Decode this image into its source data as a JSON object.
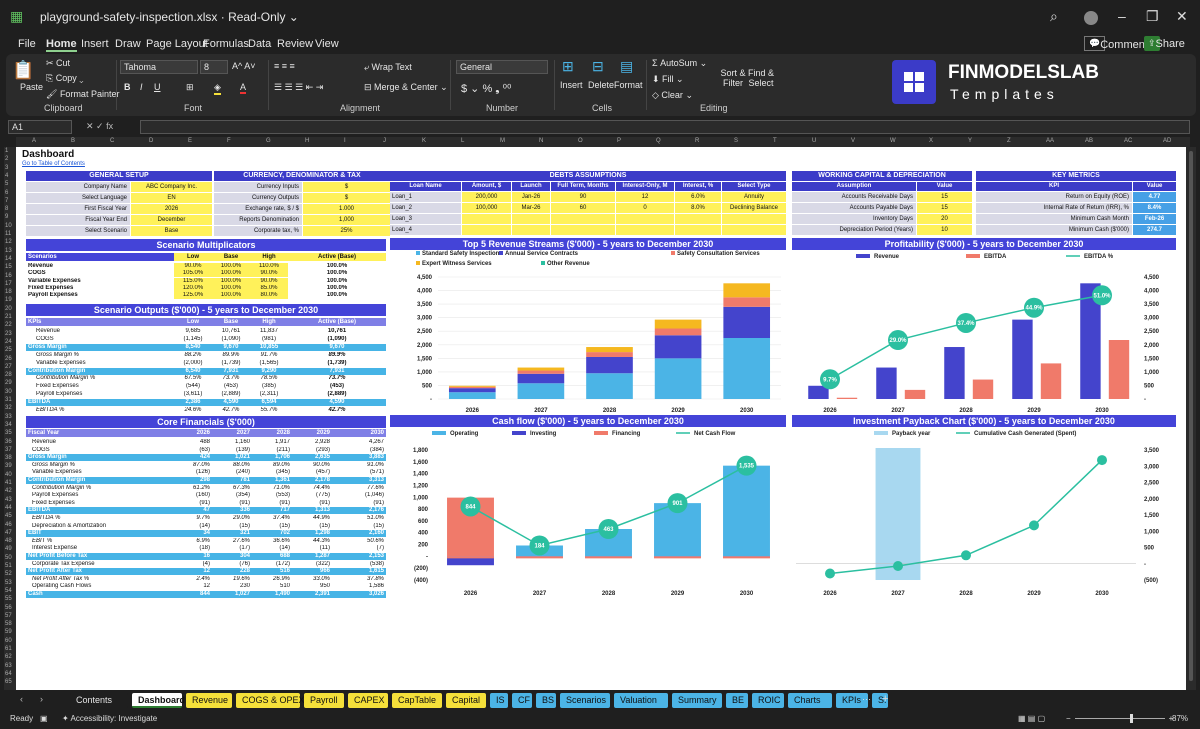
{
  "app": {
    "filename": "playground-safety-inspection.xlsx",
    "mode": "Read-Only",
    "menus": [
      "File",
      "Home",
      "Insert",
      "Draw",
      "Page Layout",
      "Formulas",
      "Data",
      "Review",
      "View"
    ],
    "comments": "Comments",
    "share": "Share"
  },
  "ribbon": {
    "paste": "Paste",
    "cut": "Cut",
    "copy": "Copy",
    "format_painter": "Format Painter",
    "clipboard": "Clipboard",
    "font_name": "Tahoma",
    "font_size": "8",
    "font": "Font",
    "wrap": "Wrap Text",
    "merge": "Merge & Center",
    "alignment": "Alignment",
    "number_format": "General",
    "number": "Number",
    "insert": "Insert",
    "delete": "Delete",
    "format": "Format",
    "cells": "Cells",
    "autosum": "AutoSum",
    "fill": "Fill",
    "clear": "Clear",
    "sort": "Sort & Filter",
    "find": "Find & Select",
    "editing": "Editing",
    "logo1": "FINMODELSLAB",
    "logo2": "Templates"
  },
  "namebox": "A1",
  "columns": [
    "A",
    "B",
    "C",
    "D",
    "E",
    "F",
    "G",
    "H",
    "I",
    "J",
    "K",
    "L",
    "M",
    "N",
    "O",
    "P",
    "Q",
    "R",
    "S",
    "T",
    "U",
    "V",
    "W",
    "X",
    "Y",
    "Z",
    "AA",
    "AB",
    "AC",
    "AD"
  ],
  "sheet": {
    "title": "Dashboard",
    "toc": "Go to Table of Contents"
  },
  "general": {
    "title": "GENERAL SETUP",
    "rows": [
      [
        "Company Name",
        "ABC Company Inc."
      ],
      [
        "Select Language",
        "EN"
      ],
      [
        "First Fiscal Year",
        "2026"
      ],
      [
        "Fiscal Year End",
        "December"
      ],
      [
        "Select Scenario",
        "Base"
      ]
    ]
  },
  "currency": {
    "title": "CURRENCY, DENOMINATOR & TAX",
    "rows": [
      [
        "Currency Inputs",
        "$"
      ],
      [
        "Currency Outputs",
        "$"
      ],
      [
        "Exchange rate, $ / $",
        "1.000"
      ],
      [
        "Reports Denomination",
        "1,000"
      ],
      [
        "Corporate tax, %",
        "25%"
      ]
    ]
  },
  "debts": {
    "title": "DEBTS ASSUMPTIONS",
    "headers": [
      "Loan Name",
      "Amount, $",
      "Launch",
      "Full Term, Months",
      "Interest-Only, M",
      "Interest, %",
      "Select Type"
    ],
    "rows": [
      [
        "Loan_1",
        "200,000",
        "Jan-26",
        "90",
        "12",
        "6.0%",
        "Annuity"
      ],
      [
        "Loan_2",
        "100,000",
        "Mar-26",
        "60",
        "0",
        "8.0%",
        "Declining Balance"
      ],
      [
        "Loan_3",
        "",
        "",
        "",
        "",
        "",
        ""
      ],
      [
        "Loan_4",
        "",
        "",
        "",
        "",
        "",
        ""
      ]
    ]
  },
  "wc": {
    "title": "WORKING CAPITAL & DEPRECIATION",
    "headers": [
      "Assumption",
      "Value"
    ],
    "rows": [
      [
        "Accounts Receivable Days",
        "15"
      ],
      [
        "Accounts Payable Days",
        "15"
      ],
      [
        "Inventory Days",
        "20"
      ],
      [
        "Depreciation Period (Years)",
        "10"
      ]
    ]
  },
  "kpi": {
    "title": "KEY METRICS",
    "headers": [
      "KPI",
      "Value"
    ],
    "rows": [
      [
        "Return on Equity (ROE)",
        "4.77"
      ],
      [
        "Internal Rate of Return (IRR), %",
        "8.4%"
      ],
      [
        "Minimum Cash Month",
        "Feb-26"
      ],
      [
        "Minimum Cash ($'000)",
        "274.7"
      ]
    ]
  },
  "multipliers": {
    "title": "Scenario Multiplicators",
    "headers": [
      "Scenarios",
      "Low",
      "Base",
      "High",
      "Active (Base)"
    ],
    "rows": [
      [
        "Revenue",
        "90.0%",
        "100.0%",
        "110.0%",
        "100.0%"
      ],
      [
        "COGS",
        "105.0%",
        "100.0%",
        "90.0%",
        "100.0%"
      ],
      [
        "Variable Expenses",
        "115.0%",
        "100.0%",
        "90.0%",
        "100.0%"
      ],
      [
        "Fixed Expenses",
        "120.0%",
        "100.0%",
        "85.0%",
        "100.0%"
      ],
      [
        "Payroll Expenses",
        "125.0%",
        "100.0%",
        "80.0%",
        "100.0%"
      ]
    ]
  },
  "outputs": {
    "title": "Scenario Outputs ($'000) - 5 years to December 2030",
    "headers": [
      "KPIs",
      "Low",
      "Base",
      "High",
      "Active (Base)"
    ],
    "rows": [
      [
        "Revenue",
        "9,685",
        "10,761",
        "11,837",
        "10,761",
        "n"
      ],
      [
        "COGS",
        "(1,145)",
        "(1,090)",
        "(981)",
        "(1,090)",
        "n"
      ],
      [
        "Gross Margin",
        "8,540",
        "9,670",
        "10,855",
        "9,670",
        "h"
      ],
      [
        "Gross Margin %",
        "88.2%",
        "89.9%",
        "91.7%",
        "89.9%",
        "i"
      ],
      [
        "Variable Expenses",
        "(2,000)",
        "(1,739)",
        "(1,565)",
        "(1,739)",
        "n"
      ],
      [
        "Contribution Margin",
        "6,540",
        "7,931",
        "9,290",
        "7,931",
        "h"
      ],
      [
        "Contribution Margin %",
        "67.5%",
        "73.7%",
        "78.5%",
        "73.7%",
        "i"
      ],
      [
        "Fixed Expenses",
        "(544)",
        "(453)",
        "(385)",
        "(453)",
        "n"
      ],
      [
        "Payroll Expenses",
        "(3,611)",
        "(2,889)",
        "(2,311)",
        "(2,889)",
        "n"
      ],
      [
        "EBITDA",
        "2,386",
        "4,590",
        "6,594",
        "4,590",
        "h"
      ],
      [
        "EBITDA %",
        "24.6%",
        "42.7%",
        "55.7%",
        "42.7%",
        "i"
      ]
    ]
  },
  "core": {
    "title": "Core Financials ($'000)",
    "headers": [
      "Fiscal Year",
      "2026",
      "2027",
      "2028",
      "2029",
      "2030"
    ],
    "rows": [
      [
        "Revenue",
        "488",
        "1,160",
        "1,917",
        "2,928",
        "4,267",
        "n"
      ],
      [
        "COGS",
        "(63)",
        "(139)",
        "(211)",
        "(293)",
        "(384)",
        "n"
      ],
      [
        "Gross Margin",
        "424",
        "1,021",
        "1,706",
        "2,635",
        "3,883",
        "h"
      ],
      [
        "Gross Margin %",
        "87.0%",
        "88.0%",
        "89.0%",
        "90.0%",
        "91.0%",
        "i"
      ],
      [
        "Variable Expenses",
        "(126)",
        "(240)",
        "(345)",
        "(457)",
        "(571)",
        "n"
      ],
      [
        "Contribution Margin",
        "298",
        "781",
        "1,361",
        "2,178",
        "3,313",
        "h"
      ],
      [
        "Contribution Margin %",
        "61.2%",
        "67.3%",
        "71.0%",
        "74.4%",
        "77.6%",
        "i"
      ],
      [
        "Payroll Expenses",
        "(160)",
        "(354)",
        "(553)",
        "(775)",
        "(1,046)",
        "n"
      ],
      [
        "Fixed Expenses",
        "(91)",
        "(91)",
        "(91)",
        "(91)",
        "(91)",
        "n"
      ],
      [
        "EBITDA",
        "47",
        "336",
        "717",
        "1,313",
        "2,176",
        "h"
      ],
      [
        "EBITDA %",
        "9.7%",
        "29.0%",
        "37.4%",
        "44.9%",
        "51.0%",
        "i"
      ],
      [
        "Depreciation & Amortization",
        "(14)",
        "(15)",
        "(15)",
        "(15)",
        "(15)",
        "n"
      ],
      [
        "EBIT",
        "34",
        "321",
        "702",
        "1,298",
        "2,160",
        "h"
      ],
      [
        "EBIT %",
        "6.9%",
        "27.6%",
        "36.6%",
        "44.3%",
        "50.6%",
        "i"
      ],
      [
        "Interest Expense",
        "(18)",
        "(17)",
        "(14)",
        "(11)",
        "(7)",
        "n"
      ],
      [
        "Net Profit Before Tax",
        "16",
        "304",
        "688",
        "1,287",
        "2,153",
        "h"
      ],
      [
        "Corporate Tax Expense",
        "(4)",
        "(76)",
        "(172)",
        "(322)",
        "(538)",
        "n"
      ],
      [
        "Net Profit After Tax",
        "12",
        "228",
        "516",
        "966",
        "1,615",
        "h"
      ],
      [
        "Net Profit After Tax %",
        "2.4%",
        "19.6%",
        "26.9%",
        "33.0%",
        "37.8%",
        "i"
      ],
      [
        "Operating Cash Flows",
        "12",
        "230",
        "510",
        "950",
        "1,586",
        "n"
      ],
      [
        "Cash",
        "844",
        "1,027",
        "1,490",
        "2,391",
        "3,026",
        "h"
      ]
    ]
  },
  "chart_data": [
    {
      "type": "bar",
      "title": "Top 5 Revenue Streams ($'000) - 5 years to December 2030",
      "categories": [
        "2026",
        "2027",
        "2028",
        "2029",
        "2030"
      ],
      "ylim": [
        0,
        4500
      ],
      "yticks": [
        "-",
        "500",
        "1,000",
        "1,500",
        "2,000",
        "2,500",
        "3,000",
        "3,500",
        "4,000",
        "4,500"
      ],
      "series": [
        {
          "name": "Standard Safety Inspections",
          "color": "#4bb4e6",
          "values": [
            250,
            580,
            950,
            1500,
            2250
          ]
        },
        {
          "name": "Annual Service Contracts",
          "color": "#4444cc",
          "values": [
            150,
            350,
            600,
            850,
            1150
          ]
        },
        {
          "name": "Safety Consultation Services",
          "color": "#f07a6a",
          "values": [
            50,
            120,
            180,
            250,
            350
          ]
        },
        {
          "name": "Expert Witness Services",
          "color": "#f5b820",
          "values": [
            38,
            110,
            187,
            328,
            517
          ]
        },
        {
          "name": "Other Revenue",
          "color": "#2bbfa0",
          "values": [
            0,
            0,
            0,
            0,
            0
          ]
        }
      ]
    },
    {
      "type": "bar+line",
      "title": "Profitability ($'000) - 5 years to December 2030",
      "categories": [
        "2026",
        "2027",
        "2028",
        "2029",
        "2030"
      ],
      "ylim": [
        0,
        4500
      ],
      "yticks": [
        "-",
        "500",
        "1,000",
        "1,500",
        "2,000",
        "2,500",
        "3,000",
        "3,500",
        "4,000",
        "4,500"
      ],
      "y2ticks": [
        "0.0%",
        "10.0%",
        "20.0%",
        "30.0%",
        "40.0%",
        "50.0%",
        "60.0%"
      ],
      "series": [
        {
          "name": "Revenue",
          "color": "#4444cc",
          "values": [
            488,
            1160,
            1917,
            2928,
            4267
          ]
        },
        {
          "name": "EBITDA",
          "color": "#f07a6a",
          "values": [
            47,
            336,
            717,
            1313,
            2176
          ]
        },
        {
          "name": "EBITDA %",
          "color": "#2bbfa0",
          "values": [
            9.7,
            29.0,
            37.4,
            44.9,
            51.0
          ],
          "labels": [
            "9.7%",
            "29.0%",
            "37.4%",
            "44.9%",
            "51.0%"
          ]
        }
      ]
    },
    {
      "type": "bar+line",
      "title": "Cash flow ($'000) - 5 years to December 2030",
      "categories": [
        "2026",
        "2027",
        "2028",
        "2029",
        "2030"
      ],
      "ylim": [
        -400,
        1800
      ],
      "yticks": [
        "(400)",
        "(200)",
        "-",
        "200",
        "400",
        "600",
        "800",
        "1,000",
        "1,200",
        "1,400",
        "1,600",
        "1,800"
      ],
      "series": [
        {
          "name": "Operating",
          "color": "#4bb4e6",
          "values": [
            0,
            184,
            463,
            901,
            1535
          ]
        },
        {
          "name": "Investing",
          "color": "#4444cc",
          "values": [
            -150,
            -25,
            -20,
            -20,
            -20
          ]
        },
        {
          "name": "Financing",
          "color": "#f07a6a",
          "values": [
            994,
            0,
            0,
            0,
            0
          ]
        },
        {
          "name": "Net Cash Flow",
          "color": "#2bbfa0",
          "values": [
            844,
            184,
            463,
            901,
            1535
          ],
          "labels": [
            "844",
            "184",
            "463",
            "901",
            "1,535"
          ]
        }
      ]
    },
    {
      "type": "bar+line",
      "title": "Investment Payback Chart ($'000) - 5 years to December 2030",
      "categories": [
        "2026",
        "2027",
        "2028",
        "2029",
        "2030"
      ],
      "ylim": [
        -500,
        3500
      ],
      "yticks": [
        "(500)",
        "-",
        "500",
        "1,000",
        "1,500",
        "2,000",
        "2,500",
        "3,000",
        "3,500"
      ],
      "series": [
        {
          "name": "Payback year",
          "color": "#a8d8f0",
          "values": [
            0,
            1,
            0,
            0,
            0
          ]
        },
        {
          "name": "Cumulative Cash Generated (Spent)",
          "color": "#2bbfa0",
          "values": [
            -300,
            -70,
            260,
            1180,
            3190
          ]
        }
      ]
    }
  ],
  "tabs": [
    {
      "label": "Contents",
      "color": "#1f1f1f",
      "fg": "#e6e6e6"
    },
    {
      "label": "Dashboard",
      "color": "#ffffff",
      "fg": "#111"
    },
    {
      "label": "Revenue",
      "color": "#f5e03a",
      "fg": "#111"
    },
    {
      "label": "COGS & OPEX",
      "color": "#f5e03a",
      "fg": "#111"
    },
    {
      "label": "Payroll",
      "color": "#f5e03a",
      "fg": "#111"
    },
    {
      "label": "CAPEX",
      "color": "#f5e03a",
      "fg": "#111"
    },
    {
      "label": "CapTable",
      "color": "#f5e03a",
      "fg": "#111"
    },
    {
      "label": "Capital",
      "color": "#f5e03a",
      "fg": "#111"
    },
    {
      "label": "IS",
      "color": "#4bb4e6",
      "fg": "#111"
    },
    {
      "label": "CF",
      "color": "#4bb4e6",
      "fg": "#111"
    },
    {
      "label": "BS",
      "color": "#4bb4e6",
      "fg": "#111"
    },
    {
      "label": "Scenarios",
      "color": "#4bb4e6",
      "fg": "#111"
    },
    {
      "label": "Valuation",
      "color": "#4bb4e6",
      "fg": "#111"
    },
    {
      "label": "Summary",
      "color": "#4bb4e6",
      "fg": "#111"
    },
    {
      "label": "BE",
      "color": "#4bb4e6",
      "fg": "#111"
    },
    {
      "label": "ROIC",
      "color": "#4bb4e6",
      "fg": "#111"
    },
    {
      "label": "Charts",
      "color": "#4bb4e6",
      "fg": "#111"
    },
    {
      "label": "KPIs",
      "color": "#4bb4e6",
      "fg": "#111"
    },
    {
      "label": "S:",
      "color": "#4bb4e6",
      "fg": "#111"
    }
  ],
  "status": {
    "ready": "Ready",
    "accessibility": "Accessibility: Investigate",
    "zoom": "87%"
  }
}
